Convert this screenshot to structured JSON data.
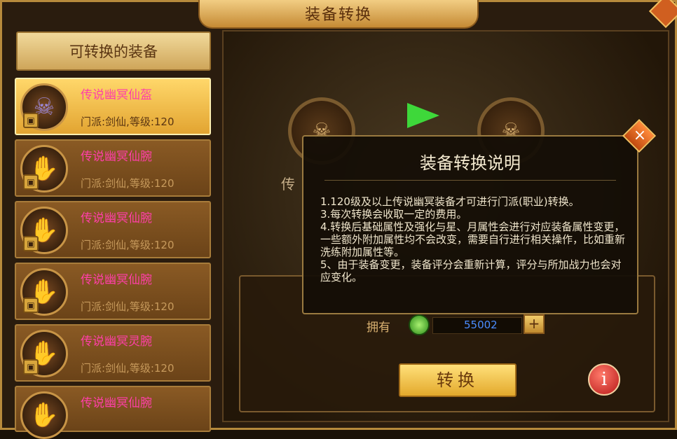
{
  "window": {
    "title": "装备转换"
  },
  "left_panel": {
    "header": "可转换的装备",
    "items": [
      {
        "name": "传说幽冥仙盔",
        "meta": "门派:剑仙,等级:120",
        "icon": "helmet-icon",
        "selected": true
      },
      {
        "name": "传说幽冥仙腕",
        "meta": "门派:剑仙,等级:120",
        "icon": "glove-icon",
        "selected": false
      },
      {
        "name": "传说幽冥仙腕",
        "meta": "门派:剑仙,等级:120",
        "icon": "glove-icon",
        "selected": false
      },
      {
        "name": "传说幽冥仙腕",
        "meta": "门派:剑仙,等级:120",
        "icon": "glove-icon",
        "selected": false
      },
      {
        "name": "传说幽冥灵腕",
        "meta": "门派:剑仙,等级:120",
        "icon": "glove-icon",
        "selected": false
      },
      {
        "name": "传说幽冥仙腕",
        "meta": "",
        "icon": "glove-icon",
        "selected": false
      }
    ]
  },
  "right_panel": {
    "bg_label": "传",
    "own_label": "拥有",
    "currency_value": "55002",
    "plus_label": "+",
    "convert_label": "转换",
    "info_label": "i"
  },
  "dialog": {
    "title": "装备转换说明",
    "close_label": "×",
    "lines": [
      "1.120级及以上传说幽冥装备才可进行门派(职业)转换。",
      "3.每次转换会收取一定的费用。",
      "4.转换后基础属性及强化与星、月属性会进行对应装备属性变更，一些额外附加属性均不会改变，需要自行进行相关操作，比如重新洗练附加属性等。",
      "5、由于装备变更，装备评分会重新计算，评分与所加战力也会对应变化。"
    ]
  },
  "colors": {
    "item_name": "#ff3fa8",
    "currency": "#4a8cff",
    "arrow": "#3ed83a"
  }
}
